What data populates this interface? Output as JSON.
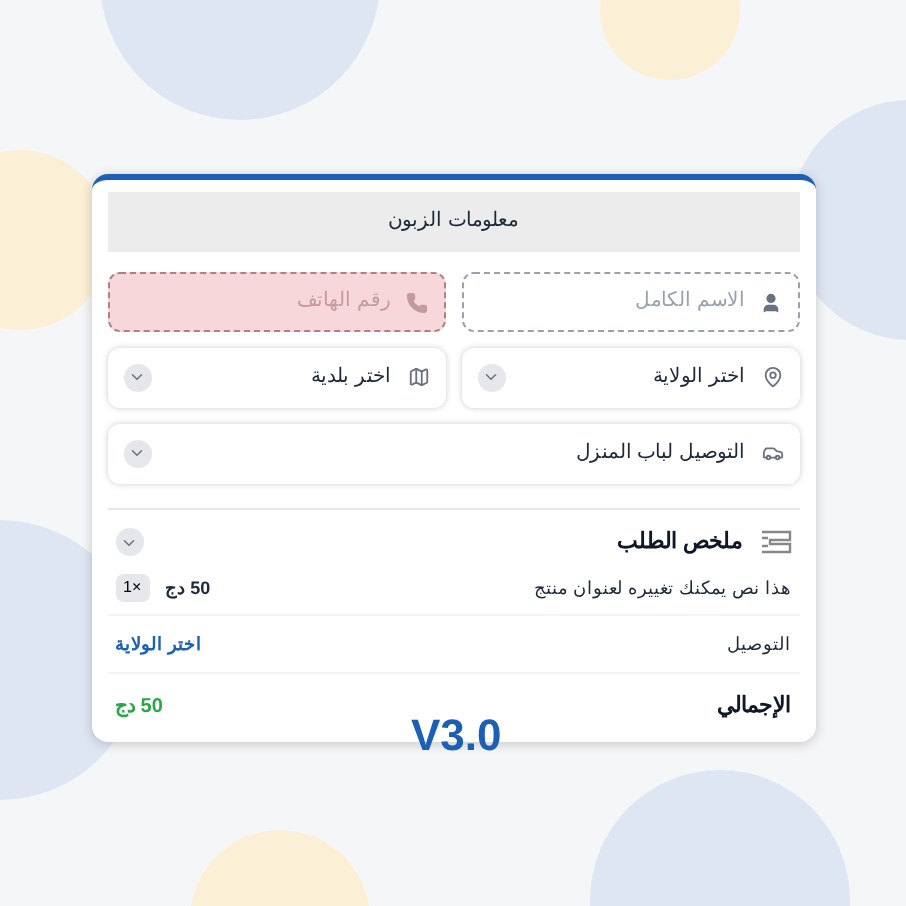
{
  "customer_section": {
    "title": "معلومات الزبون"
  },
  "fields": [
    {
      "placeholder": "الاسم الكامل",
      "invalid": false
    },
    {
      "placeholder": "رقم الهاتف",
      "invalid": true
    }
  ],
  "selects": [
    {
      "value": "اختر الولاية"
    },
    {
      "value": "اختر بلدية"
    },
    {
      "value": "التوصيل لباب المنزل"
    }
  ],
  "summary": {
    "title": "ملخص الطلب",
    "items": [
      {
        "name": "هذا نص يمكنك تغييره لعنوان منتج",
        "price": "50 دج",
        "quantity": "1×"
      }
    ],
    "delivery": {
      "label": "التوصيل",
      "value": "اختر الولاية"
    },
    "total": {
      "label": "الإجمالي",
      "value": "50 دج"
    }
  },
  "version": "V3.0"
}
